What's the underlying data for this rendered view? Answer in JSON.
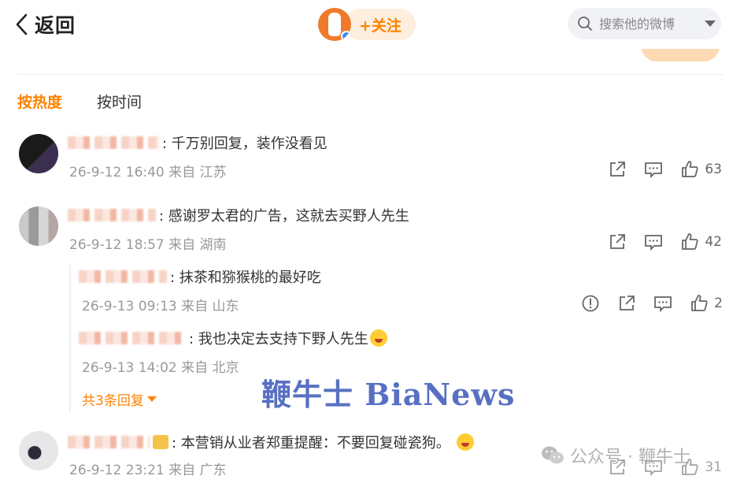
{
  "topbar": {
    "back_label": "返回",
    "follow_label": "+关注",
    "search_placeholder": "搜索他的微博"
  },
  "sort_tabs": [
    {
      "label": "按热度",
      "active": true
    },
    {
      "label": "按时间",
      "active": false
    }
  ],
  "comments": [
    {
      "text": ": 千万别回复，装作没看见",
      "meta": "26-9-12 16:40 来自 江苏",
      "likes": "63"
    },
    {
      "text": ": 感谢罗太君的广告，这就去买野人先生",
      "meta": "26-9-12 18:57 来自 湖南",
      "likes": "42",
      "replies": [
        {
          "text": ": 抹茶和猕猴桃的最好吃",
          "meta": "26-9-13 09:13 来自 山东",
          "likes": "2"
        },
        {
          "text": ": 我也决定去支持下野人先生",
          "meta": "26-9-13 14:02 来自 北京"
        }
      ],
      "more_replies": "共3条回复"
    },
    {
      "text": ": 本营销从业者郑重提醒：不要回复碰瓷狗。",
      "meta": "26-9-12 23:21 来自 广东",
      "likes": "31"
    }
  ],
  "watermark": "鞭牛士 BiaNews",
  "wechat_watermark": "公众号 · 鞭牛士",
  "colors": {
    "accent": "#ff8200",
    "meta_gray": "#999999",
    "watermark_blue": "#3a58b8"
  }
}
